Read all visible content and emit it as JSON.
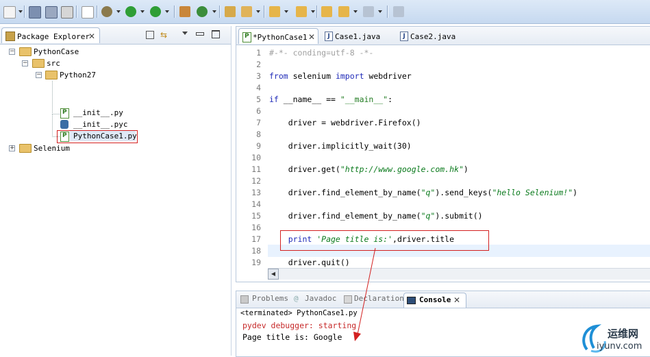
{
  "toolbar": {
    "icons": [
      "new-icon",
      "save-icon",
      "save-all-icon",
      "print-icon",
      "skip-breakpoints-icon",
      "debug-icon",
      "run-icon",
      "external-tools-icon",
      "new-java-project-icon",
      "new-class-icon",
      "open-type-icon",
      "search-icon",
      "next-annotation-icon",
      "previous-annotation-icon",
      "back-icon",
      "forward-icon",
      "pin-editor-icon"
    ]
  },
  "explorer": {
    "title": "Package Explorer",
    "tree": [
      {
        "label": "PythonCase",
        "level": 0,
        "type": "project"
      },
      {
        "label": "src",
        "level": 1,
        "type": "folder"
      },
      {
        "label": "Python27",
        "level": 2,
        "type": "folder"
      },
      {
        "label": "__init__.py",
        "level": 3,
        "type": "py"
      },
      {
        "label": "__init__.pyc",
        "level": 3,
        "type": "pyc"
      },
      {
        "label": "PythonCase1.py",
        "level": 3,
        "type": "py",
        "selected": true
      },
      {
        "label": "Selenium",
        "level": 0,
        "type": "project"
      }
    ]
  },
  "editor": {
    "tabs": [
      {
        "label": "*PythonCase1",
        "active": true
      },
      {
        "label": "Case1.java",
        "active": false
      },
      {
        "label": "Case2.java",
        "active": false
      }
    ],
    "line_numbers": [
      "1",
      "2",
      "3",
      "4",
      "5",
      "6",
      "7",
      "8",
      "9",
      "10",
      "11",
      "12",
      "13",
      "14",
      "15",
      "16",
      "17",
      "18",
      "19"
    ],
    "code": {
      "l1": "#-*- conding=utf-8 -*-",
      "l3_kw1": "from",
      "l3_mid": " selenium ",
      "l3_kw2": "import",
      "l3_end": " webdriver",
      "l5_kw": "if",
      "l5_mid": " __name__ == ",
      "l5_str": "\"__main__\"",
      "l5_end": ":",
      "l7": "    driver = webdriver.Firefox()",
      "l9": "    driver.implicitly_wait(30)",
      "l11_a": "    driver.get(",
      "l11_str": "\"http://www.google.com.hk\"",
      "l11_b": ")",
      "l13_a": "    driver.find_element_by_name(",
      "l13_s1": "\"q\"",
      "l13_b": ").send_keys(",
      "l13_s2": "\"hello Selenium!\"",
      "l13_c": ")",
      "l15_a": "    driver.find_element_by_name(",
      "l15_s": "\"q\"",
      "l15_b": ").submit()",
      "l17_kw": "    print",
      "l17_str": " 'Page title is:'",
      "l17_end": ",driver.title",
      "l19": "    driver.quit()"
    }
  },
  "console": {
    "tabs": [
      {
        "label": "Problems",
        "active": false
      },
      {
        "label": "Javadoc",
        "active": false
      },
      {
        "label": "Declaration",
        "active": false
      },
      {
        "label": "Console",
        "active": true
      }
    ],
    "terminated": "<terminated> PythonCase1.py",
    "lines": [
      "pydev debugger: starting",
      "Page title is: Google"
    ],
    "colors": {
      "debug": "#c62828",
      "output": "#000000"
    }
  },
  "watermark": {
    "name": "运维网",
    "url": "iyunv.com"
  }
}
